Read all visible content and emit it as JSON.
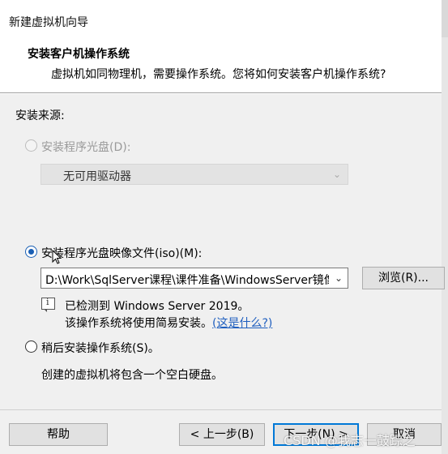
{
  "window": {
    "title": "新建虚拟机向导"
  },
  "header": {
    "title": "安装客户机操作系统",
    "subtitle": "虚拟机如同物理机，需要操作系统。您将如何安装客户机操作系统?"
  },
  "source": {
    "label": "安装来源:",
    "disc_option": {
      "label": "安装程序光盘(D):",
      "checked": false,
      "enabled": false,
      "drive_select": "无可用驱动器"
    },
    "iso_option": {
      "label": "安装程序光盘映像文件(iso)(M):",
      "checked": true,
      "enabled": true,
      "path": "D:\\Work\\SqlServer课程\\课件准备\\WindowsServer镜像",
      "browse_label": "浏览(R)...",
      "detected": "已检测到 Windows Server 2019。",
      "easy_install": "该操作系统将使用简易安装。",
      "whats_this": "(这是什么?)"
    },
    "later_option": {
      "label": "稍后安装操作系统(S)。",
      "checked": false,
      "description": "创建的虚拟机将包含一个空白硬盘。"
    }
  },
  "footer": {
    "help_label": "帮助",
    "back_label": "< 上一步(B)",
    "next_label": "下一步(N) >",
    "cancel_label": "取消"
  },
  "watermark": "CSDN @我志一鼓踪之",
  "colors": {
    "accent": "#0078d7",
    "radio_checked": "#1a5fb4",
    "link": "#1f5fbf"
  }
}
